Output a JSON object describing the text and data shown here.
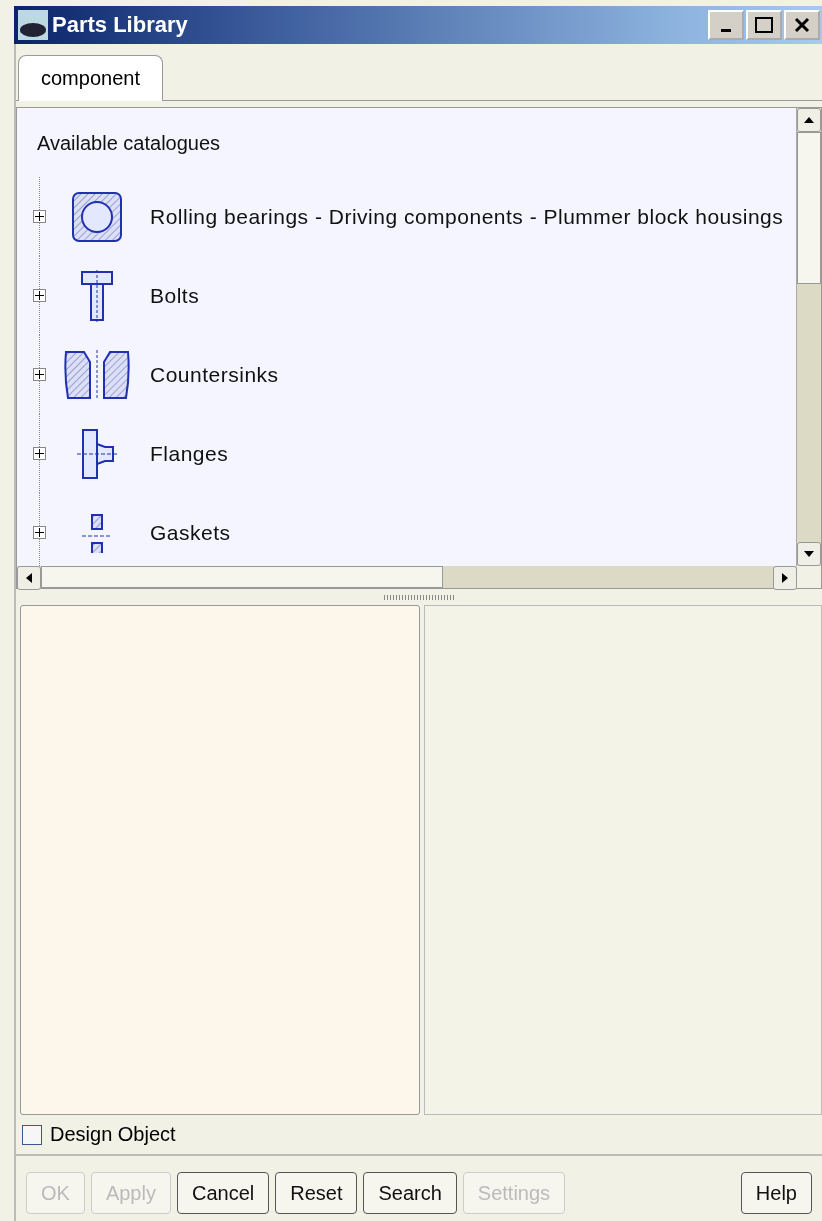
{
  "window": {
    "title": "Parts Library"
  },
  "tabs": [
    {
      "label": "component",
      "selected": true
    }
  ],
  "tree": {
    "heading": "Available catalogues",
    "items": [
      {
        "label": "Rolling bearings - Driving components - Plummer block housings",
        "expanded": false
      },
      {
        "label": "Bolts",
        "expanded": false
      },
      {
        "label": "Countersinks",
        "expanded": false
      },
      {
        "label": "Flanges",
        "expanded": false
      },
      {
        "label": "Gaskets",
        "expanded": false
      }
    ]
  },
  "design_object": {
    "label": "Design Object",
    "checked": false
  },
  "buttons": [
    {
      "label": "OK",
      "disabled": true
    },
    {
      "label": "Apply",
      "disabled": true
    },
    {
      "label": "Cancel",
      "disabled": false
    },
    {
      "label": "Reset",
      "disabled": false
    },
    {
      "label": "Search",
      "disabled": false
    },
    {
      "label": "Settings",
      "disabled": true
    },
    {
      "label": "Help",
      "disabled": false,
      "kind": "right"
    }
  ]
}
